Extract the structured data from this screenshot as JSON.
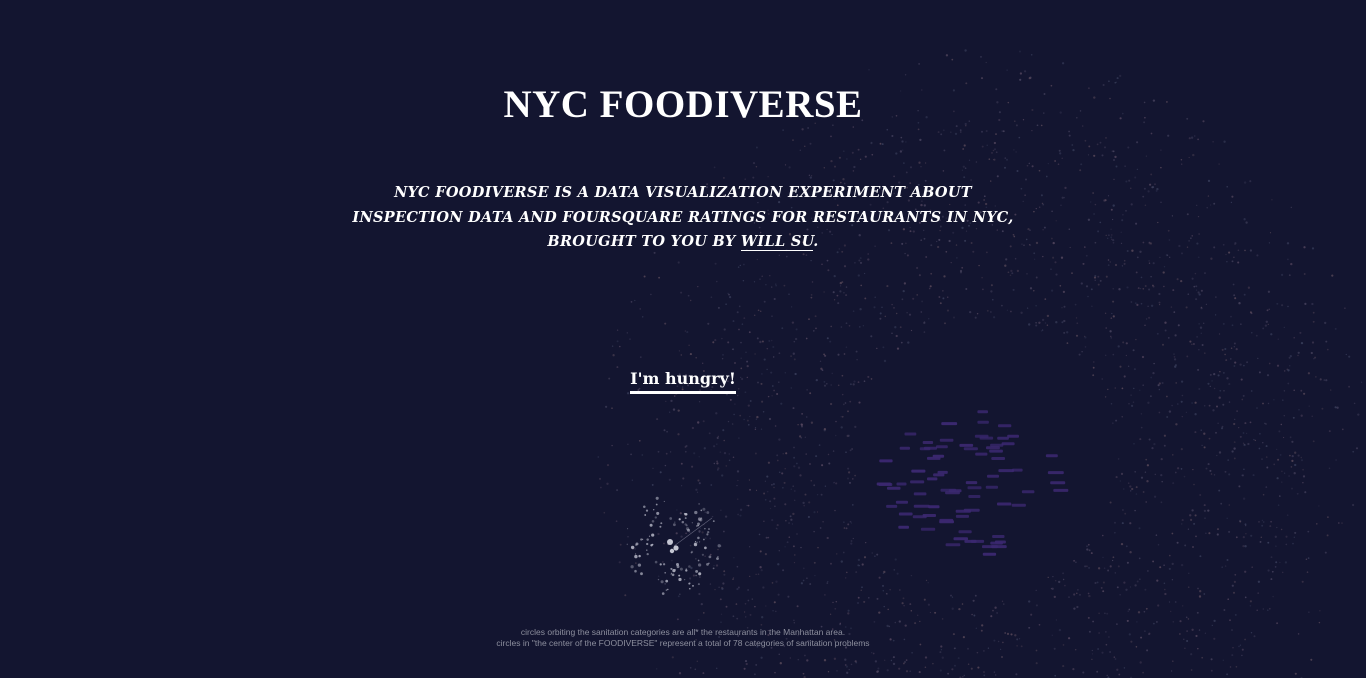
{
  "header": {
    "title": "NYC FOODIVERSE"
  },
  "intro": {
    "text_before": "NYC FOODIVERSE IS A DATA VISUALIZATION EXPERIMENT ABOUT INSPECTION DATA AND FOURSQUARE RATINGS FOR RESTAURANTS IN NYC, BROUGHT TO YOU BY ",
    "author_link": "WILL SU",
    "text_after": "."
  },
  "cta": {
    "label": "I'm hungry!"
  },
  "footnote": {
    "line1": "circles orbiting the sanitation categories are all* the restaurants in the Manhattan area.",
    "line2": "circles in \"the center of the FOODIVERSE\" represent a total of 78 categories of sanitation problems"
  },
  "colors": {
    "background": "#131530",
    "text": "#ffffff",
    "footnote": "#8d8f9e",
    "category_labels": "#3b2870",
    "restaurant_dots": "#4a4560"
  }
}
